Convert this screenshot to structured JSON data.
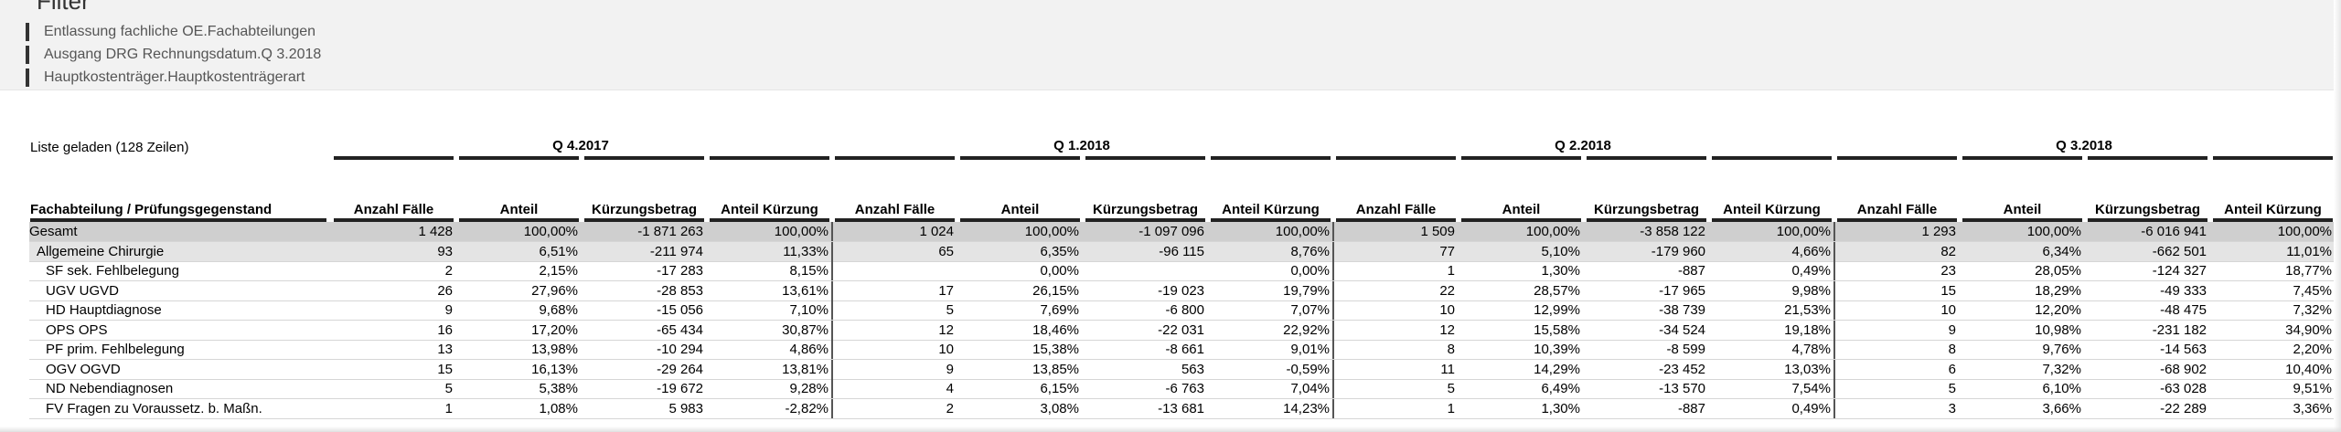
{
  "filter": {
    "title": "Filter",
    "items": [
      "Entlassung fachliche OE.Fachabteilungen",
      "Ausgang DRG Rechnungsdatum.Q 3.2018",
      "Hauptkostenträger.Hauptkostenträgerart"
    ]
  },
  "status": "Liste geladen (128 Zeilen)",
  "quarters": [
    "Q 4.2017",
    "Q 1.2018",
    "Q 2.2018",
    "Q 3.2018"
  ],
  "columns": {
    "row_label": "Fachabteilung / Prüfungsgegenstand",
    "per_quarter": [
      "Anzahl Fälle",
      "Anteil",
      "Kürzungsbetrag",
      "Anteil Kürzung"
    ]
  },
  "rows": [
    {
      "label": "Gesamt",
      "level": "total",
      "values": [
        "1 428",
        "100,00%",
        "-1 871 263",
        "100,00%",
        "1 024",
        "100,00%",
        "-1 097 096",
        "100,00%",
        "1 509",
        "100,00%",
        "-3 858 122",
        "100,00%",
        "1 293",
        "100,00%",
        "-6 016 941",
        "100,00%"
      ]
    },
    {
      "label": "Allgemeine Chirurgie",
      "level": "group",
      "values": [
        "93",
        "6,51%",
        "-211 974",
        "11,33%",
        "65",
        "6,35%",
        "-96 115",
        "8,76%",
        "77",
        "5,10%",
        "-179 960",
        "4,66%",
        "82",
        "6,34%",
        "-662 501",
        "11,01%"
      ]
    },
    {
      "label": "SF sek. Fehlbelegung",
      "level": "item",
      "values": [
        "2",
        "2,15%",
        "-17 283",
        "8,15%",
        "",
        "0,00%",
        "",
        "0,00%",
        "1",
        "1,30%",
        "-887",
        "0,49%",
        "23",
        "28,05%",
        "-124 327",
        "18,77%"
      ]
    },
    {
      "label": "UGV UGVD",
      "level": "item",
      "values": [
        "26",
        "27,96%",
        "-28 853",
        "13,61%",
        "17",
        "26,15%",
        "-19 023",
        "19,79%",
        "22",
        "28,57%",
        "-17 965",
        "9,98%",
        "15",
        "18,29%",
        "-49 333",
        "7,45%"
      ]
    },
    {
      "label": "HD Hauptdiagnose",
      "level": "item",
      "values": [
        "9",
        "9,68%",
        "-15 056",
        "7,10%",
        "5",
        "7,69%",
        "-6 800",
        "7,07%",
        "10",
        "12,99%",
        "-38 739",
        "21,53%",
        "10",
        "12,20%",
        "-48 475",
        "7,32%"
      ]
    },
    {
      "label": "OPS OPS",
      "level": "item",
      "values": [
        "16",
        "17,20%",
        "-65 434",
        "30,87%",
        "12",
        "18,46%",
        "-22 031",
        "22,92%",
        "12",
        "15,58%",
        "-34 524",
        "19,18%",
        "9",
        "10,98%",
        "-231 182",
        "34,90%"
      ]
    },
    {
      "label": "PF prim. Fehlbelegung",
      "level": "item",
      "values": [
        "13",
        "13,98%",
        "-10 294",
        "4,86%",
        "10",
        "15,38%",
        "-8 661",
        "9,01%",
        "8",
        "10,39%",
        "-8 599",
        "4,78%",
        "8",
        "9,76%",
        "-14 563",
        "2,20%"
      ]
    },
    {
      "label": "OGV OGVD",
      "level": "item",
      "values": [
        "15",
        "16,13%",
        "-29 264",
        "13,81%",
        "9",
        "13,85%",
        "563",
        "-0,59%",
        "11",
        "14,29%",
        "-23 452",
        "13,03%",
        "6",
        "7,32%",
        "-68 902",
        "10,40%"
      ]
    },
    {
      "label": "ND Nebendiagnosen",
      "level": "item",
      "values": [
        "5",
        "5,38%",
        "-19 672",
        "9,28%",
        "4",
        "6,15%",
        "-6 763",
        "7,04%",
        "5",
        "6,49%",
        "-13 570",
        "7,54%",
        "5",
        "6,10%",
        "-63 028",
        "9,51%"
      ]
    },
    {
      "label": "FV Fragen zu Voraussetz. b. Maßn.",
      "level": "item",
      "values": [
        "1",
        "1,08%",
        "5 983",
        "-2,82%",
        "2",
        "3,08%",
        "-13 681",
        "14,23%",
        "1",
        "1,30%",
        "-887",
        "0,49%",
        "3",
        "3,66%",
        "-22 289",
        "3,36%"
      ]
    }
  ]
}
